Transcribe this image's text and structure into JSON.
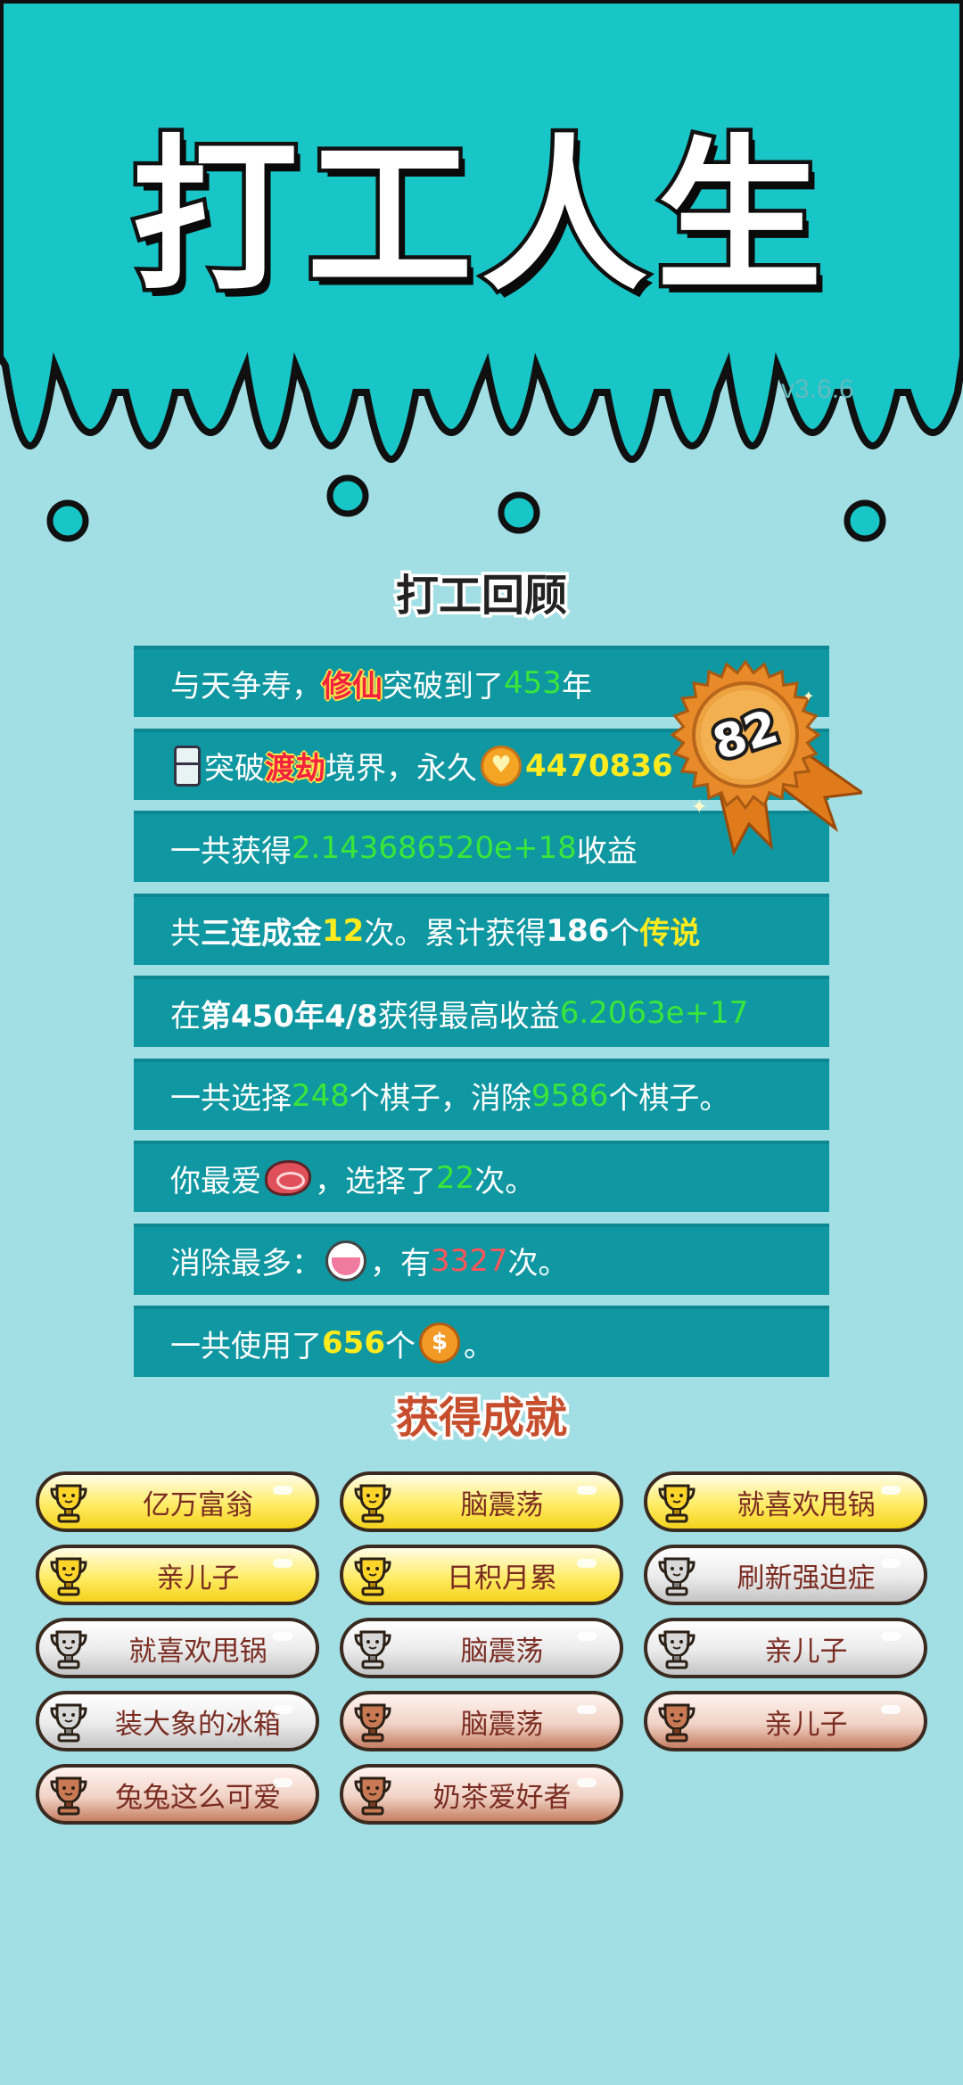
{
  "app": {
    "title": "打工人生",
    "version": "v3.6.6"
  },
  "review": {
    "title": "打工回顾",
    "rows": [
      {
        "parts": [
          {
            "t": "与天争寿，"
          },
          {
            "t": "修仙",
            "c": "hl"
          },
          {
            "t": "突破到了"
          },
          {
            "t": "453",
            "c": "g"
          },
          {
            "t": "年"
          }
        ]
      },
      {
        "parts": [
          {
            "icon": "fridge-icon"
          },
          {
            "t": "突破"
          },
          {
            "t": "渡劫",
            "c": "hl"
          },
          {
            "t": "境界，永久"
          },
          {
            "icon": "heart-coin-icon"
          },
          {
            "t": "4470836",
            "c": "y"
          }
        ]
      },
      {
        "parts": [
          {
            "t": "一共获得"
          },
          {
            "t": "2.143686520e+18",
            "c": "g"
          },
          {
            "t": "收益"
          }
        ]
      },
      {
        "parts": [
          {
            "t": "共"
          },
          {
            "t": "三连成金",
            "c": "b"
          },
          {
            "t": "12",
            "c": "y"
          },
          {
            "t": "次。累计获得"
          },
          {
            "t": "186",
            "c": "b"
          },
          {
            "t": "个"
          },
          {
            "t": "传说",
            "c": "y"
          }
        ]
      },
      {
        "parts": [
          {
            "t": "在 "
          },
          {
            "t": "第450年4/8",
            "c": "b"
          },
          {
            "t": " 获得最高收益"
          },
          {
            "t": "6.2063e+17",
            "c": "g"
          }
        ]
      },
      {
        "parts": [
          {
            "t": "一共选择"
          },
          {
            "t": "248",
            "c": "g"
          },
          {
            "t": "个棋子，消除"
          },
          {
            "t": "9586",
            "c": "g"
          },
          {
            "t": "个棋子。"
          }
        ]
      },
      {
        "parts": [
          {
            "t": "你最爱"
          },
          {
            "icon": "steak-icon"
          },
          {
            "t": "，选择了"
          },
          {
            "t": "22",
            "c": "g"
          },
          {
            "t": "次。"
          }
        ]
      },
      {
        "parts": [
          {
            "t": "消除最多："
          },
          {
            "icon": "bowl-icon"
          },
          {
            "t": "，有"
          },
          {
            "t": "3327",
            "c": "r"
          },
          {
            "t": "次。"
          }
        ]
      },
      {
        "parts": [
          {
            "t": "一共使用了"
          },
          {
            "t": "656",
            "c": "y"
          },
          {
            "t": "个"
          },
          {
            "icon": "coin-icon"
          },
          {
            "t": "。"
          }
        ]
      }
    ],
    "badge_score": "82"
  },
  "achievements": {
    "title": "获得成就",
    "items": [
      {
        "label": "亿万富翁",
        "tier": "gold"
      },
      {
        "label": "脑震荡",
        "tier": "gold"
      },
      {
        "label": "就喜欢甩锅",
        "tier": "gold"
      },
      {
        "label": "亲儿子",
        "tier": "gold"
      },
      {
        "label": "日积月累",
        "tier": "gold"
      },
      {
        "label": "刷新强迫症",
        "tier": "silver"
      },
      {
        "label": "就喜欢甩锅",
        "tier": "silver"
      },
      {
        "label": "脑震荡",
        "tier": "silver"
      },
      {
        "label": "亲儿子",
        "tier": "silver"
      },
      {
        "label": "装大象的冰箱",
        "tier": "silver"
      },
      {
        "label": "脑震荡",
        "tier": "bronze"
      },
      {
        "label": "亲儿子",
        "tier": "bronze"
      },
      {
        "label": "兔兔这么可爱",
        "tier": "bronze"
      },
      {
        "label": "奶茶爱好者",
        "tier": "bronze"
      }
    ]
  },
  "colors": {
    "header_bg": "#18c6c8",
    "body_bg": "#a2dfe5",
    "row_bg": "#0f97a2",
    "green": "#39e63a",
    "yellow": "#ffeb1e",
    "badge": "#e98a2a"
  }
}
